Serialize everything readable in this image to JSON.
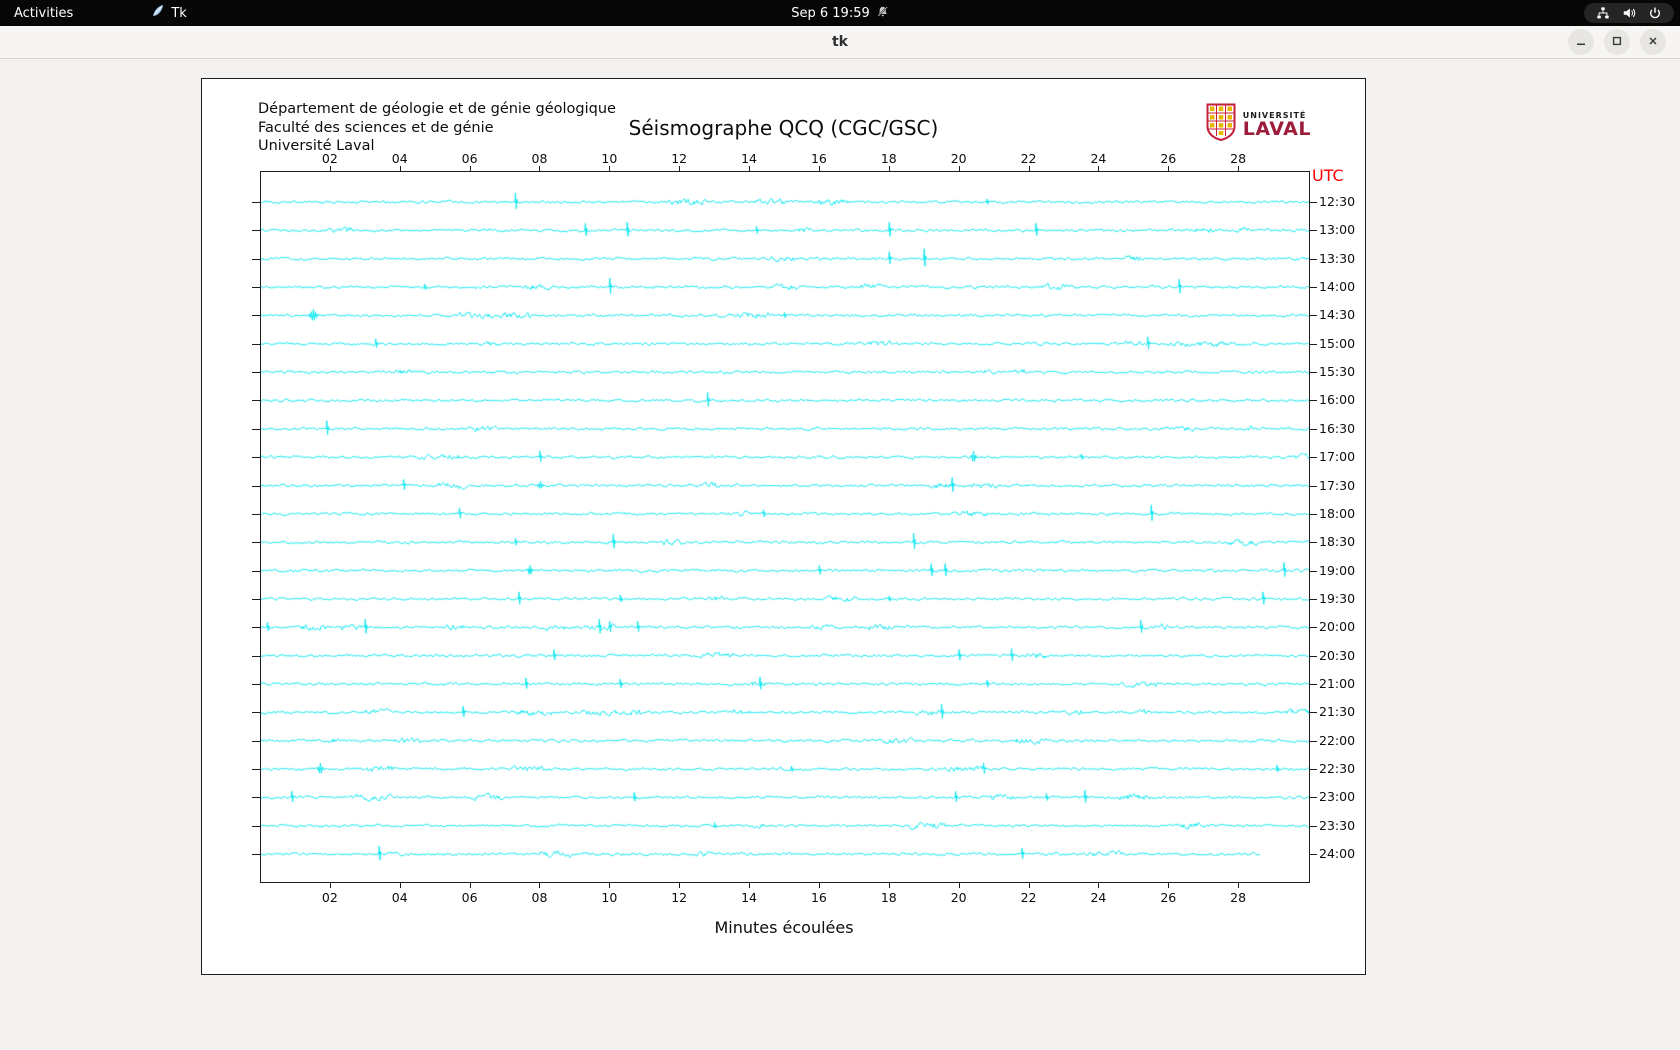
{
  "top_bar": {
    "activities": "Activities",
    "app_name": "Tk",
    "clock": "Sep 6 19:59"
  },
  "window": {
    "title": "tk"
  },
  "page": {
    "institution_lines": [
      "Département de géologie et de génie géologique",
      "Faculté des sciences et de génie",
      "Université Laval"
    ],
    "title": "Séismographe QCQ (CGC/GSC)",
    "logo": {
      "line1": "UNIVERSITÉ",
      "line2": "LAVAL"
    },
    "utc_label": "UTC",
    "xlabel": "Minutes écoulées"
  },
  "chart_data": {
    "type": "line",
    "subtype": "seismogram-helicorder",
    "title": "Séismographe QCQ (CGC/GSC)",
    "xlabel": "Minutes écoulées",
    "right_axis_label": "UTC",
    "x_range_minutes": [
      0,
      30
    ],
    "x_ticks": [
      "02",
      "04",
      "06",
      "08",
      "10",
      "12",
      "14",
      "16",
      "18",
      "20",
      "22",
      "24",
      "26",
      "28"
    ],
    "trace_color": "#00E5EE",
    "amplitude_units": "px",
    "rows": [
      {
        "label": "12:30",
        "spikes": [
          {
            "m": 7.3,
            "a": 9
          },
          {
            "m": 20.8,
            "a": 3
          }
        ]
      },
      {
        "label": "13:00",
        "spikes": [
          {
            "m": 9.3,
            "a": 7
          },
          {
            "m": 10.5,
            "a": 8
          },
          {
            "m": 14.2,
            "a": 4
          },
          {
            "m": 18.0,
            "a": 8
          },
          {
            "m": 22.2,
            "a": 7
          }
        ]
      },
      {
        "label": "13:30",
        "spikes": [
          {
            "m": 18.0,
            "a": 7
          },
          {
            "m": 19.0,
            "a": 10
          }
        ]
      },
      {
        "label": "14:00",
        "spikes": [
          {
            "m": 4.7,
            "a": 3
          },
          {
            "m": 10.0,
            "a": 9
          },
          {
            "m": 26.3,
            "a": 8
          }
        ]
      },
      {
        "label": "14:30",
        "spikes": [
          {
            "m": 1.5,
            "a": 6,
            "w": 9
          },
          {
            "m": 15.0,
            "a": 3
          }
        ]
      },
      {
        "label": "15:00",
        "spikes": [
          {
            "m": 3.3,
            "a": 5
          },
          {
            "m": 25.4,
            "a": 7
          }
        ]
      },
      {
        "label": "15:30",
        "spikes": []
      },
      {
        "label": "16:00",
        "spikes": [
          {
            "m": 12.8,
            "a": 8
          }
        ]
      },
      {
        "label": "16:30",
        "spikes": [
          {
            "m": 1.9,
            "a": 8
          }
        ]
      },
      {
        "label": "17:00",
        "spikes": [
          {
            "m": 8.0,
            "a": 6
          },
          {
            "m": 20.4,
            "a": 6,
            "w": 5
          },
          {
            "m": 23.5,
            "a": 3
          }
        ]
      },
      {
        "label": "17:30",
        "spikes": [
          {
            "m": 4.1,
            "a": 6
          },
          {
            "m": 8.0,
            "a": 4,
            "w": 5
          },
          {
            "m": 19.8,
            "a": 8
          }
        ]
      },
      {
        "label": "18:00",
        "spikes": [
          {
            "m": 5.7,
            "a": 6
          },
          {
            "m": 14.4,
            "a": 4
          },
          {
            "m": 25.5,
            "a": 9
          }
        ]
      },
      {
        "label": "18:30",
        "spikes": [
          {
            "m": 7.3,
            "a": 4
          },
          {
            "m": 10.1,
            "a": 8
          },
          {
            "m": 18.7,
            "a": 9
          }
        ]
      },
      {
        "label": "19:00",
        "spikes": [
          {
            "m": 7.7,
            "a": 5,
            "w": 5
          },
          {
            "m": 16.0,
            "a": 5
          },
          {
            "m": 19.2,
            "a": 7
          },
          {
            "m": 19.6,
            "a": 7
          },
          {
            "m": 29.3,
            "a": 8
          }
        ]
      },
      {
        "label": "19:30",
        "spikes": [
          {
            "m": 7.4,
            "a": 7
          },
          {
            "m": 10.3,
            "a": 4
          },
          {
            "m": 18.0,
            "a": 3
          },
          {
            "m": 28.7,
            "a": 7
          }
        ]
      },
      {
        "label": "20:00",
        "spikes": [
          {
            "m": 0.2,
            "a": 5
          },
          {
            "m": 3.0,
            "a": 8
          },
          {
            "m": 9.7,
            "a": 8
          },
          {
            "m": 10.0,
            "a": 6
          },
          {
            "m": 10.8,
            "a": 6
          },
          {
            "m": 25.2,
            "a": 7
          }
        ]
      },
      {
        "label": "20:30",
        "spikes": [
          {
            "m": 8.4,
            "a": 6
          },
          {
            "m": 20.0,
            "a": 6
          },
          {
            "m": 21.5,
            "a": 7
          }
        ]
      },
      {
        "label": "21:00",
        "spikes": [
          {
            "m": 7.6,
            "a": 6
          },
          {
            "m": 10.3,
            "a": 5
          },
          {
            "m": 14.3,
            "a": 7
          },
          {
            "m": 20.8,
            "a": 4
          }
        ]
      },
      {
        "label": "21:30",
        "spikes": [
          {
            "m": 5.8,
            "a": 6
          },
          {
            "m": 19.5,
            "a": 8
          }
        ]
      },
      {
        "label": "22:00",
        "spikes": []
      },
      {
        "label": "22:30",
        "spikes": [
          {
            "m": 1.7,
            "a": 6,
            "w": 5
          },
          {
            "m": 15.2,
            "a": 3
          },
          {
            "m": 20.7,
            "a": 6
          },
          {
            "m": 29.1,
            "a": 4
          }
        ]
      },
      {
        "label": "23:00",
        "spikes": [
          {
            "m": 0.9,
            "a": 6
          },
          {
            "m": 10.7,
            "a": 5
          },
          {
            "m": 19.9,
            "a": 6
          },
          {
            "m": 22.5,
            "a": 4
          },
          {
            "m": 23.6,
            "a": 7
          }
        ]
      },
      {
        "label": "23:30",
        "spikes": [
          {
            "m": 13.0,
            "a": 3
          }
        ]
      },
      {
        "label": "24:00",
        "end": 28.6,
        "spikes": [
          {
            "m": 3.4,
            "a": 8
          },
          {
            "m": 21.8,
            "a": 6
          }
        ]
      }
    ]
  }
}
